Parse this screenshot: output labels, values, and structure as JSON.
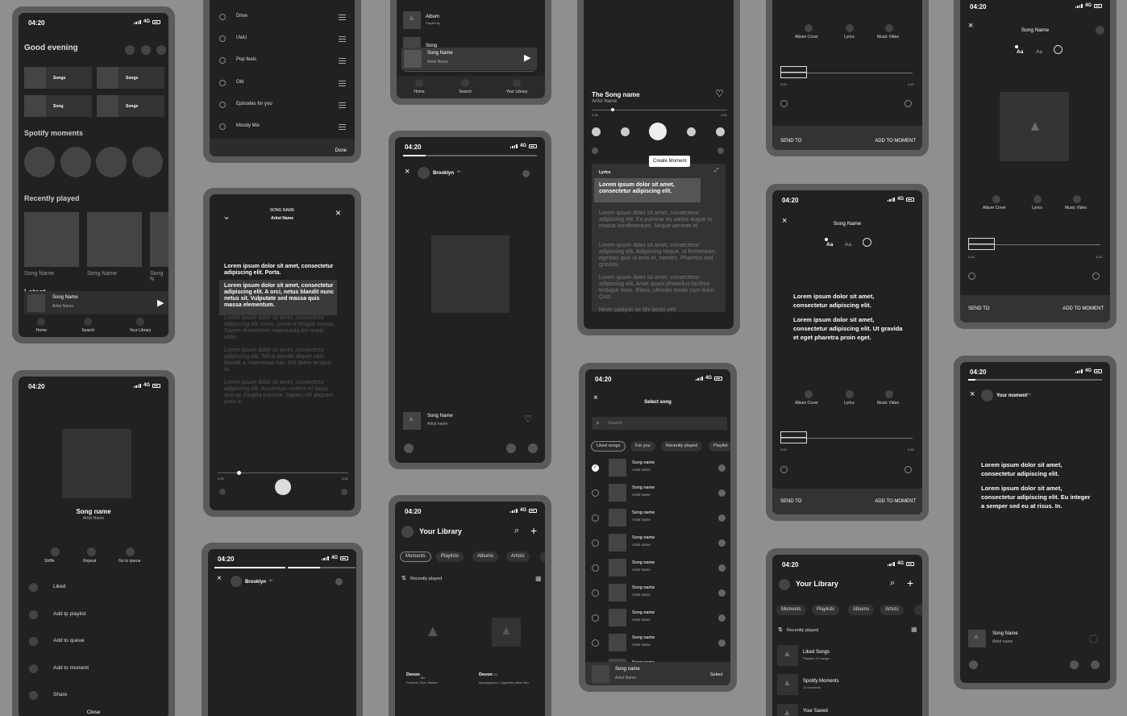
{
  "status": {
    "time": "04:20",
    "net": "4G"
  },
  "home": {
    "greeting": "Good evening",
    "tiles": [
      "Songs",
      "Songs",
      "Song",
      "Songs"
    ],
    "moments_title": "Spotify moments",
    "recent_title": "Recently played",
    "recent_items": [
      "Song Name",
      "Song Name",
      "Song N"
    ],
    "latest_label": "Latest",
    "mini_song": "Song Name",
    "mini_artist": "Artist Name",
    "nav": [
      "Home",
      "Search",
      "Your Library"
    ]
  },
  "playlists": {
    "items": [
      "Drive",
      "UwU",
      "Pop feels",
      "Old",
      "Episodes for you",
      "Moody Mix"
    ],
    "done": "Done"
  },
  "libtop": {
    "item1": "Album",
    "item1_sub": "Playlist by",
    "item2": "Song",
    "mini_song": "Song Name",
    "mini_artist": "Artist Name",
    "nav": [
      "Home",
      "Search",
      "Your Library"
    ]
  },
  "nowplaying": {
    "title": "The Song name",
    "artist": "Artist Name",
    "t_start": "0:34",
    "t_end": "4:20",
    "lyrics_label": "Lyrics",
    "create_moment": "Create Moment",
    "lines": [
      "Lorem ipsum dolor sit amet, consectetur adipiscing elit.",
      "Lorem ipsum dolor sit amet, consectetur adipiscing elit. Eu pulvinar eu varius augue in massa condimentum. Neque aenean et.",
      "Lorem ipsum dolor sit amet, consectetur adipiscing elit. Adipiscing neque, ut fermentum egestas quis ut eros et, montes. Pharetra sed gravida.",
      "Lorem ipsum dolor sit amet, consectetur adipiscing elit. Amet quam phasellus facilisis tristique nunc. Risus, ultricies morbi cum dolor. Quis.",
      "Hmm sadiyon se bhi lambi yeh",
      "Mera ki amavasein hain"
    ]
  },
  "editor": {
    "tabs": [
      "Album Cover",
      "Lyrics",
      "Music Video"
    ],
    "t_start": "0:34",
    "t_end": "4:20",
    "send": "SEND TO",
    "add": "ADD TO MOMENT",
    "song": "Song Name",
    "font_a": "Aa",
    "font_b": "Aa",
    "lines": [
      "Lorem ipsum dolor sit amet, consectetur adipiscing elit.",
      "Lorem ipsum dolor sit amet, consectetur adipiscing elit. Ut gravida et eget pharetra proin eget."
    ]
  },
  "lyricsfull": {
    "song": "SONG NAME",
    "artist": "Artist Name",
    "lines": [
      "Lorem ipsum dolor sit amet, consectetur adipiscing elit. Porta.",
      "Lorem ipsum dolor sit amet, consectetur adipiscing elit. A orci, netus blandit nunc netus sit. Vulputate sed massa quis massa elementum.",
      "Lorem ipsum dolor sit amet, consectetur adipiscing elit. Nunc, porta ut feugiat massa. Sapien fermentum malesuada leo morbi vitae.",
      "Lorem ipsum dolor sit amet, consectetur adipiscing elit. Tellus blandit aliquet odio blandit a, maecenas hac. Elit libero tempus ut.",
      "Lorem ipsum dolor sit amet, consectetur adipiscing elit. Accumsan viverra mi lacus quis ac fringilla pulvinar. Sapien elit aliquam justo in."
    ],
    "t_start": "0:00",
    "t_end": "0:00"
  },
  "story": {
    "user": "Brooklyn",
    "time": "8h",
    "song": "Song Name",
    "artist": "Artist name"
  },
  "songmenu": {
    "song": "Song name",
    "artist": "Artist Name",
    "actions": [
      "Shffle",
      "Repeat",
      "Go to queue"
    ],
    "items": [
      "Liked",
      "Add tp playlist",
      "Add to queue",
      "Add to moment",
      "Share"
    ],
    "close": "Close"
  },
  "library": {
    "title": "Your Library",
    "pills": [
      "Moments",
      "Playlists",
      "Albums",
      "Artists"
    ],
    "sort": "Recently played",
    "cards": [
      {
        "name": "Devon",
        "time": "8hr",
        "sub": "Federal • Ruin Walker"
      },
      {
        "name": "Devon",
        "time": "1hr",
        "sub": "Apocalypses • Cigarettes After Sex"
      }
    ],
    "list": [
      {
        "name": "Liked Songs",
        "sub": "Playlist • 20 songs"
      },
      {
        "name": "Spotify Moments",
        "sub": "10 moments"
      },
      {
        "name": "Your Saved",
        "sub": ""
      }
    ]
  },
  "select": {
    "title": "Select song",
    "search": "Search",
    "pills": [
      "Liked songs",
      "For you",
      "Recently played",
      "Playlist"
    ],
    "song": "Song name",
    "artist": "Artist name",
    "bottom_song": "Song name",
    "bottom_artist": "Artist Name",
    "select": "Select"
  },
  "moment": {
    "user": "Your moment",
    "time": "2d",
    "lines": [
      "Lorem ipsum dolor sit amet, consectetur adipiscing elit.",
      "Lorem ipsum dolor sit amet, consectetur adipiscing elit. Eu integer a semper sed eu at risus. In."
    ],
    "song": "Song Name",
    "artist": "Artist name"
  }
}
